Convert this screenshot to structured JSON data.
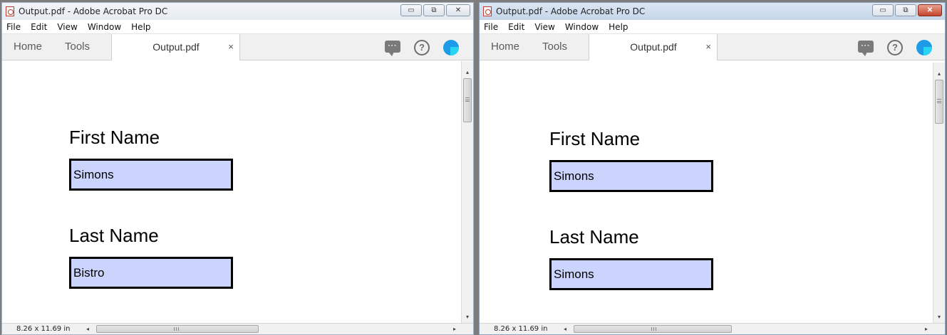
{
  "windows": [
    {
      "title": "Output.pdf - Adobe Acrobat Pro DC",
      "menu": [
        "File",
        "Edit",
        "View",
        "Window",
        "Help"
      ],
      "window_buttons": {
        "minimize": "▭",
        "maximize": "⧉",
        "close": "✕"
      },
      "toolbar": {
        "home": "Home",
        "tools": "Tools",
        "document_tab": "Output.pdf",
        "close_tab": "×",
        "comment_icon": "comment-icon",
        "help_icon": "help-icon",
        "help_glyph": "?",
        "avatar_icon": "account-avatar-icon"
      },
      "form": {
        "first_name_label": "First Name",
        "first_name_value": "Simons",
        "last_name_label": "Last Name",
        "last_name_value": "Bistro"
      },
      "status": {
        "page_size": "8.26 x 11.69 in",
        "scroll_left": "◂",
        "scroll_right": "▸",
        "scroll_up": "▴",
        "scroll_down": "▾"
      },
      "colors": {
        "field_fill": "#cad4fc",
        "avatar": "#1e9be8"
      }
    },
    {
      "title": "Output.pdf - Adobe Acrobat Pro DC",
      "menu": [
        "File",
        "Edit",
        "View",
        "Window",
        "Help"
      ],
      "window_buttons": {
        "minimize": "▭",
        "maximize": "⧉",
        "close": "✕"
      },
      "toolbar": {
        "home": "Home",
        "tools": "Tools",
        "document_tab": "Output.pdf",
        "close_tab": "×",
        "comment_icon": "comment-icon",
        "help_icon": "help-icon",
        "help_glyph": "?",
        "avatar_icon": "account-avatar-icon"
      },
      "form": {
        "first_name_label": "First Name",
        "first_name_value": "Simons",
        "last_name_label": "Last Name",
        "last_name_value": "Simons"
      },
      "status": {
        "page_size": "8.26 x 11.69 in",
        "scroll_left": "◂",
        "scroll_right": "▸",
        "scroll_up": "▴",
        "scroll_down": "▾"
      },
      "colors": {
        "field_fill": "#cad4fc",
        "avatar": "#1e9be8"
      }
    }
  ]
}
